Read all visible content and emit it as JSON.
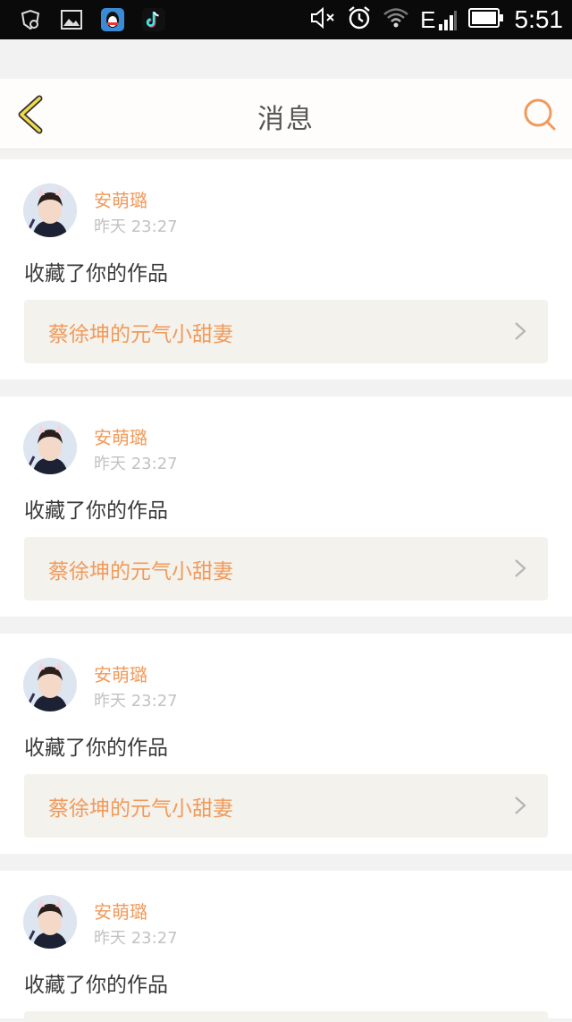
{
  "status_bar": {
    "time": "5:51",
    "network": "E",
    "icons_left": [
      "vpn-icon",
      "gallery-icon",
      "qq-icon",
      "tiktok-icon"
    ],
    "icons_right": [
      "mute-icon",
      "alarm-icon",
      "wifi-icon",
      "signal-icon",
      "battery-icon"
    ]
  },
  "nav": {
    "title": "消息",
    "accent_color": "#f19a5b"
  },
  "notifications": [
    {
      "user": "安萌璐",
      "time": "昨天 23:27",
      "action": "收藏了你的作品",
      "work_title": "蔡徐坤的元气小甜妻"
    },
    {
      "user": "安萌璐",
      "time": "昨天 23:27",
      "action": "收藏了你的作品",
      "work_title": "蔡徐坤的元气小甜妻"
    },
    {
      "user": "安萌璐",
      "time": "昨天 23:27",
      "action": "收藏了你的作品",
      "work_title": "蔡徐坤的元气小甜妻"
    },
    {
      "user": "安萌璐",
      "time": "昨天 23:27",
      "action": "收藏了你的作品",
      "work_title": ""
    }
  ]
}
